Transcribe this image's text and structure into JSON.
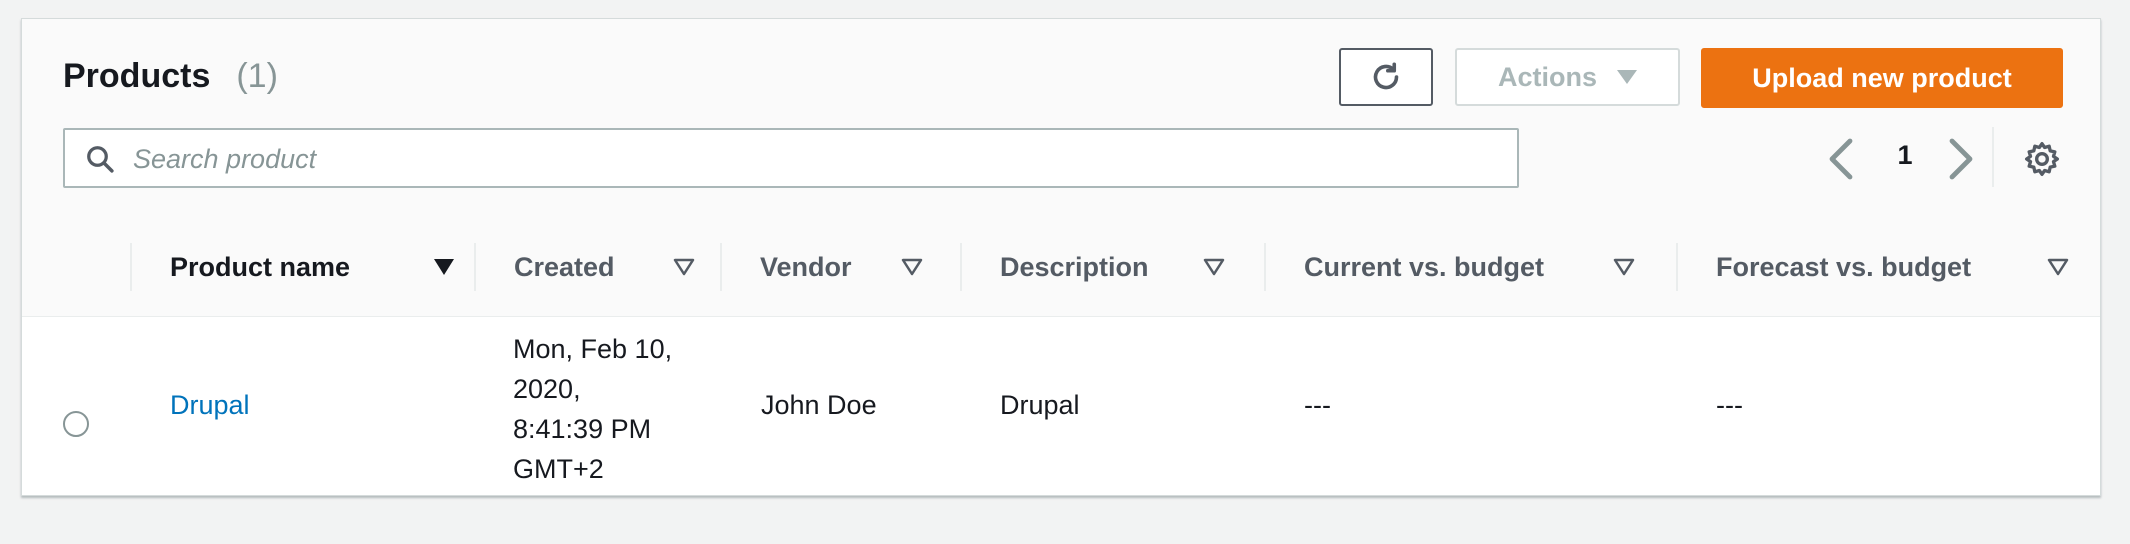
{
  "header": {
    "title": "Products",
    "count": "(1)",
    "refresh_icon": "refresh-icon",
    "actions_label": "Actions",
    "upload_label": "Upload new product"
  },
  "search": {
    "placeholder": "Search product",
    "value": "",
    "icon": "search-icon"
  },
  "pagination": {
    "current_page": "1",
    "prev_icon": "chevron-left-icon",
    "next_icon": "chevron-right-icon",
    "settings_icon": "gear-icon"
  },
  "table": {
    "columns": [
      {
        "label": "Product name",
        "sorted": true
      },
      {
        "label": "Created",
        "sorted": false
      },
      {
        "label": "Vendor",
        "sorted": false
      },
      {
        "label": "Description",
        "sorted": false
      },
      {
        "label": "Current vs. budget",
        "sorted": false
      },
      {
        "label": "Forecast vs. budget",
        "sorted": false
      }
    ],
    "rows": [
      {
        "selected": false,
        "product_name": "Drupal",
        "created_lines": [
          "Mon, Feb 10,",
          "2020,",
          "8:41:39 PM",
          "GMT+2"
        ],
        "vendor": "John Doe",
        "description": "Drupal",
        "current_vs_budget": "---",
        "forecast_vs_budget": "---"
      }
    ]
  },
  "colors": {
    "accent": "#ec7211",
    "link": "#0073bb",
    "text": "#16191f",
    "muted": "#879596"
  }
}
